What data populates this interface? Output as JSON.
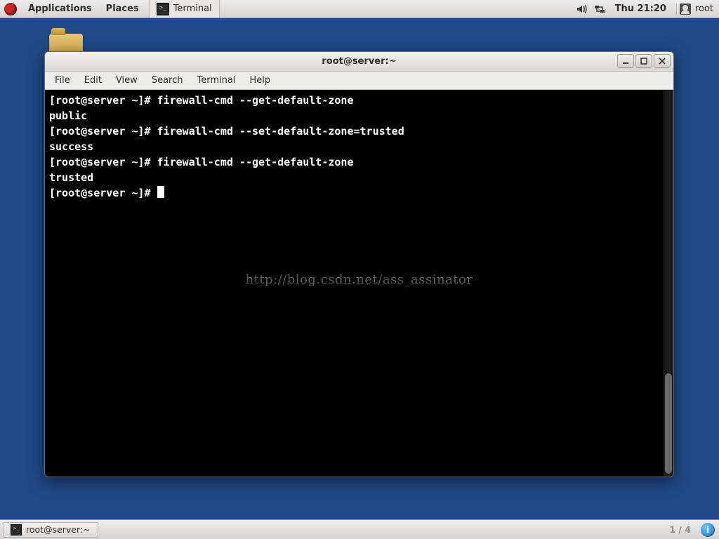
{
  "top_panel": {
    "applications": "Applications",
    "places": "Places",
    "task_label": "Terminal",
    "clock": "Thu 21:20",
    "user": "root"
  },
  "window": {
    "title": "root@server:~",
    "menus": [
      "File",
      "Edit",
      "View",
      "Search",
      "Terminal",
      "Help"
    ]
  },
  "terminal": {
    "lines": [
      {
        "prompt": "[root@server ~]# ",
        "cmd": "firewall-cmd --get-default-zone"
      },
      {
        "out": "public"
      },
      {
        "prompt": "[root@server ~]# ",
        "cmd": "firewall-cmd --set-default-zone=trusted"
      },
      {
        "out": "success"
      },
      {
        "prompt": "[root@server ~]# ",
        "cmd": "firewall-cmd --get-default-zone"
      },
      {
        "out": "trusted"
      },
      {
        "prompt": "[root@server ~]# ",
        "cursor": true
      }
    ],
    "watermark": "http://blog.csdn.net/ass_assinator"
  },
  "bottom_panel": {
    "task_label": "root@server:~",
    "workspace": "1 / 4"
  }
}
